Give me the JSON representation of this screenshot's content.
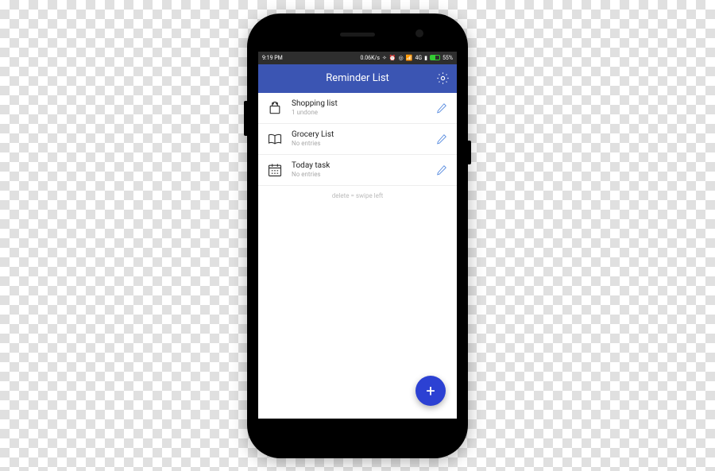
{
  "statusbar": {
    "time": "9:19 PM",
    "netspeed": "0.06K/s",
    "signal": "4G",
    "battery_pct": "55%"
  },
  "appbar": {
    "title": "Reminder List"
  },
  "items": [
    {
      "title": "Shopping list",
      "subtitle": "1 undone",
      "icon": "shopping"
    },
    {
      "title": "Grocery List",
      "subtitle": "No entries",
      "icon": "book"
    },
    {
      "title": "Today task",
      "subtitle": "No entries",
      "icon": "calendar"
    }
  ],
  "hint": "delete = swipe left",
  "fab_label": "+"
}
